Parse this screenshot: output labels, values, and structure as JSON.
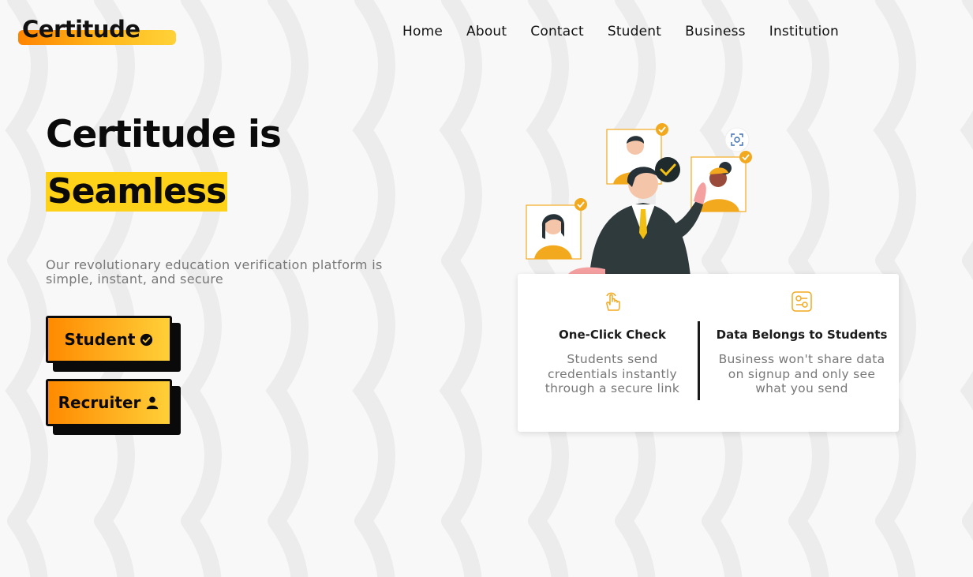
{
  "brand": {
    "name": "Certitude",
    "accent": "#ffb81c",
    "accent_start": "#ff8400",
    "highlight": "#ffd21a"
  },
  "nav": {
    "items": [
      {
        "label": "Home"
      },
      {
        "label": "About"
      },
      {
        "label": "Contact"
      },
      {
        "label": "Student"
      },
      {
        "label": "Business"
      },
      {
        "label": "Institution"
      }
    ]
  },
  "hero": {
    "title": "Certitude is",
    "highlight": "Seamless",
    "subtitle": "Our revolutionary education verification platform is simple, instant, and secure"
  },
  "cta": {
    "student": {
      "label": "Student",
      "icon": "check-circle-icon"
    },
    "recruiter": {
      "label": "Recruiter",
      "icon": "user-icon"
    }
  },
  "illustration": {
    "icons": [
      "checkmark-badge-icon",
      "scan-face-icon"
    ]
  },
  "features": [
    {
      "icon": "tap-hand-icon",
      "title": "One-Click Check",
      "text": "Students send credentials instantly through a secure link"
    },
    {
      "icon": "settings-toggle-icon",
      "title": "Data Belongs to Students",
      "text": "Business won't share data on signup and only see what you send"
    }
  ]
}
